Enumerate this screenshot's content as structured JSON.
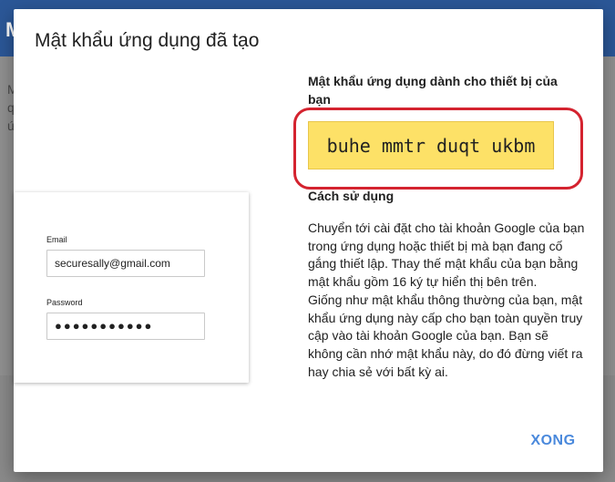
{
  "background": {
    "topbar_letter": "M",
    "text_lines": [
      "M",
      "q",
      "ứ"
    ]
  },
  "dialog": {
    "title": "Mật khẩu ứng dụng đã tạo",
    "password_heading": "Mật khẩu ứng dụng dành cho thiết bị của bạn",
    "app_password": "buhe mmtr duqt ukbm",
    "usage_heading": "Cách sử dụng",
    "usage_text": "Chuyển tới cài đặt cho tài khoản Google của bạn trong ứng dụng hoặc thiết bị mà bạn đang cố gắng thiết lập. Thay thế mật khẩu của bạn bằng mật khẩu gồm 16 ký tự hiển thị bên trên.\nGiống như mật khẩu thông thường của bạn, mật khẩu ứng dụng này cấp cho bạn toàn quyền truy cập vào tài khoản Google của bạn. Bạn sẽ không cần nhớ mật khẩu này, do đó đừng viết ra hay chia sẻ với bất kỳ ai.",
    "done_label": "XONG"
  },
  "login_illustration": {
    "email_label": "Email",
    "email_value": "securesally@gmail.com",
    "password_label": "Password",
    "password_value": "●●●●●●●●●●●"
  },
  "colors": {
    "password_highlight": "#fde167",
    "annotation_ring": "#d4232f",
    "button_text": "#4a89dc"
  }
}
